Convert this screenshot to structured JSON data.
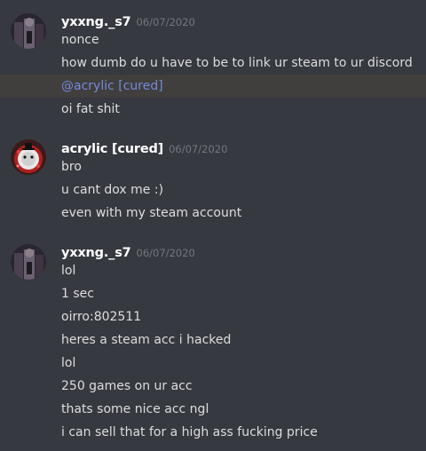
{
  "colors": {
    "background": "#36393f",
    "username": "#ffffff",
    "timestamp": "#72767d",
    "message_text": "#dcddde",
    "mention": "#7289da"
  },
  "groups": [
    {
      "username": "yxxng._s7",
      "timestamp": "06/07/2020",
      "avatar": "user-avatar-dark",
      "messages": [
        {
          "text": "nonce",
          "mention": false
        },
        {
          "text": "how dumb do u have to be to link ur steam to ur discord",
          "mention": false
        },
        {
          "text": "@acrylic [cured]",
          "mention": true
        },
        {
          "text": "oi fat shit",
          "mention": false
        }
      ]
    },
    {
      "username": "acrylic [cured]",
      "timestamp": "06/07/2020",
      "avatar": "user-avatar-red",
      "messages": [
        {
          "text": "bro",
          "mention": false
        },
        {
          "text": "u cant dox me :)",
          "mention": false
        },
        {
          "text": "even with my steam account",
          "mention": false
        }
      ]
    },
    {
      "username": "yxxng._s7",
      "timestamp": "06/07/2020",
      "avatar": "user-avatar-dark",
      "messages": [
        {
          "text": "lol",
          "mention": false
        },
        {
          "text": "1 sec",
          "mention": false
        },
        {
          "text": "oirro:802511",
          "mention": false
        },
        {
          "text": "heres a steam acc i hacked",
          "mention": false
        },
        {
          "text": "lol",
          "mention": false
        },
        {
          "text": "250 games on ur acc",
          "mention": false
        },
        {
          "text": "thats some nice acc ngl",
          "mention": false
        },
        {
          "text": "i can sell that for a high ass fucking price",
          "mention": false
        }
      ]
    }
  ]
}
